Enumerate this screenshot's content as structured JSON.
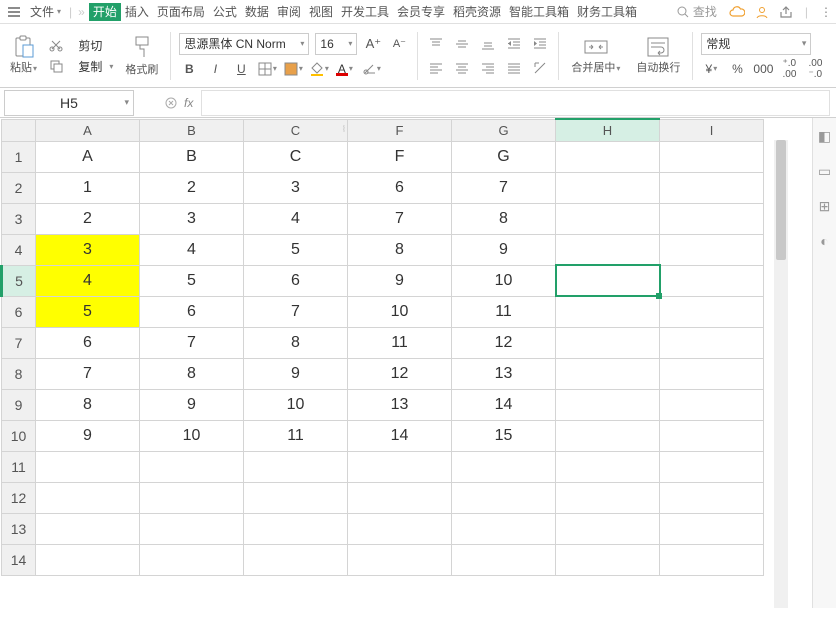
{
  "menubar": {
    "file": "文件",
    "tabs": [
      "开始",
      "插入",
      "页面布局",
      "公式",
      "数据",
      "审阅",
      "视图",
      "开发工具",
      "会员专享",
      "稻壳资源",
      "智能工具箱",
      "财务工具箱"
    ],
    "active_index": 0,
    "search_placeholder": "查找"
  },
  "ribbon": {
    "paste": "粘贴",
    "cut": "剪切",
    "copy": "复制",
    "format_painter": "格式刷",
    "font_name": "思源黑体 CN Norm",
    "font_size": "16",
    "merge_center": "合并居中",
    "wrap_text": "自动换行",
    "number_format": "常规",
    "currency": "¥",
    "percent": "%",
    "thousands": "000",
    "inc_dec": ".0",
    "dec_inc": ".00"
  },
  "namebox": "H5",
  "fx_label": "fx",
  "chart_data": {
    "type": "table",
    "columns": [
      "A",
      "B",
      "C",
      "F",
      "G",
      "H",
      "I"
    ],
    "selected_cell": "H5",
    "highlighted_yellow": [
      "A4",
      "A5",
      "A6"
    ],
    "rows": [
      {
        "n": 1,
        "A": "A",
        "B": "B",
        "C": "C",
        "F": "F",
        "G": "G",
        "H": "",
        "I": ""
      },
      {
        "n": 2,
        "A": "1",
        "B": "2",
        "C": "3",
        "F": "6",
        "G": "7",
        "H": "",
        "I": ""
      },
      {
        "n": 3,
        "A": "2",
        "B": "3",
        "C": "4",
        "F": "7",
        "G": "8",
        "H": "",
        "I": ""
      },
      {
        "n": 4,
        "A": "3",
        "B": "4",
        "C": "5",
        "F": "8",
        "G": "9",
        "H": "",
        "I": ""
      },
      {
        "n": 5,
        "A": "4",
        "B": "5",
        "C": "6",
        "F": "9",
        "G": "10",
        "H": "",
        "I": ""
      },
      {
        "n": 6,
        "A": "5",
        "B": "6",
        "C": "7",
        "F": "10",
        "G": "11",
        "H": "",
        "I": ""
      },
      {
        "n": 7,
        "A": "6",
        "B": "7",
        "C": "8",
        "F": "11",
        "G": "12",
        "H": "",
        "I": ""
      },
      {
        "n": 8,
        "A": "7",
        "B": "8",
        "C": "9",
        "F": "12",
        "G": "13",
        "H": "",
        "I": ""
      },
      {
        "n": 9,
        "A": "8",
        "B": "9",
        "C": "10",
        "F": "13",
        "G": "14",
        "H": "",
        "I": ""
      },
      {
        "n": 10,
        "A": "9",
        "B": "10",
        "C": "11",
        "F": "14",
        "G": "15",
        "H": "",
        "I": ""
      },
      {
        "n": 11,
        "A": "",
        "B": "",
        "C": "",
        "F": "",
        "G": "",
        "H": "",
        "I": ""
      },
      {
        "n": 12,
        "A": "",
        "B": "",
        "C": "",
        "F": "",
        "G": "",
        "H": "",
        "I": ""
      },
      {
        "n": 13,
        "A": "",
        "B": "",
        "C": "",
        "F": "",
        "G": "",
        "H": "",
        "I": ""
      },
      {
        "n": 14,
        "A": "",
        "B": "",
        "C": "",
        "F": "",
        "G": "",
        "H": "",
        "I": ""
      }
    ]
  }
}
